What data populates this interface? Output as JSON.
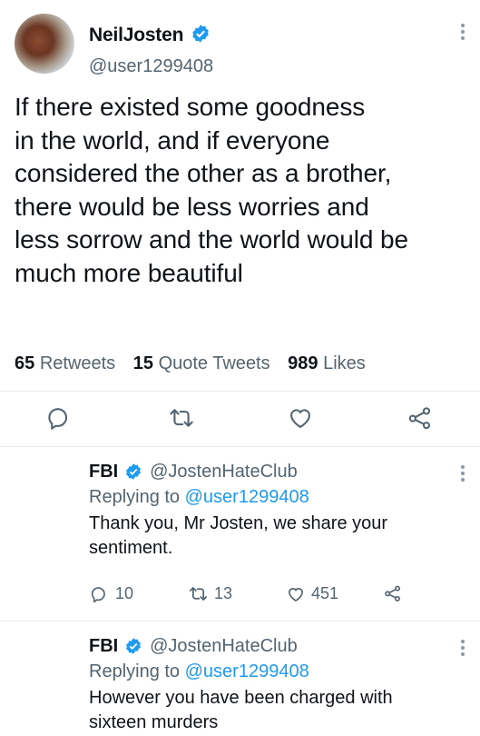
{
  "tweet": {
    "display_name": "NeilJosten",
    "handle": "@user1299408",
    "text_lines": [
      "If there existed some goodness",
      "in the world, and if everyone",
      "considered the other as a brother,",
      "there would be less worries and",
      "less sorrow and the world would be",
      "much more beautiful"
    ]
  },
  "stats": {
    "retweets_count": "65",
    "retweets_label": "Retweets",
    "quotes_count": "15",
    "quotes_label": "Quote Tweets",
    "likes_count": "989",
    "likes_label": "Likes"
  },
  "replies": [
    {
      "name": "FBI",
      "handle": "@JostenHateClub",
      "replying_prefix": "Replying to",
      "replying_to": "@user1299408",
      "text_lines": [
        "Thank you, Mr Josten, we share your",
        "sentiment."
      ],
      "reply_count": "10",
      "retweet_count": "13",
      "like_count": "451"
    },
    {
      "name": "FBI",
      "handle": "@JostenHateClub",
      "replying_prefix": "Replying to",
      "replying_to": "@user1299408",
      "text_lines": [
        "However you have been charged with",
        "sixteen murders"
      ]
    }
  ],
  "colors": {
    "accent": "#1d9bf0",
    "muted": "#536471",
    "text": "#0f1419",
    "divider": "#e6ecf0"
  },
  "icons": [
    "verified-badge-icon",
    "more-options-icon",
    "reply-icon",
    "retweet-icon",
    "like-icon",
    "share-icon"
  ]
}
